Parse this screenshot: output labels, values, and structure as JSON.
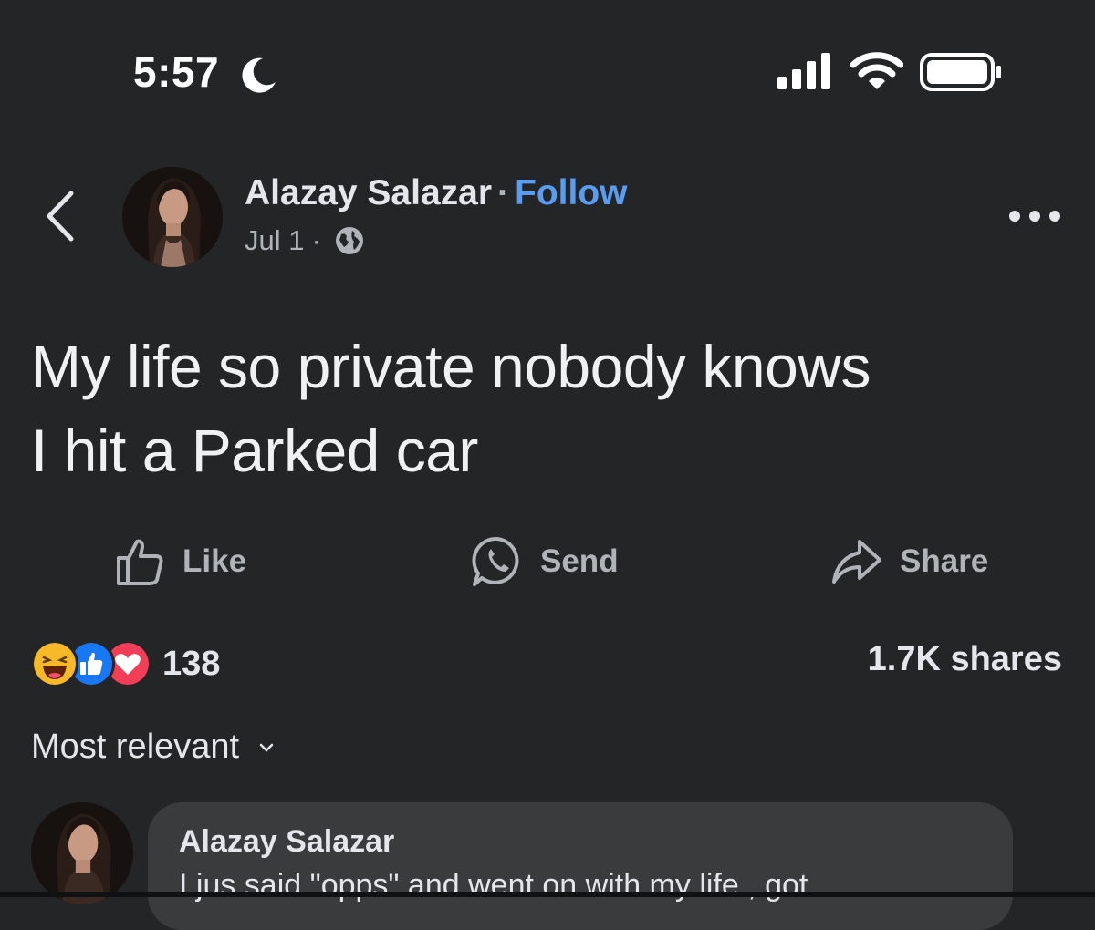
{
  "status_bar": {
    "time": "5:57",
    "icons": [
      "moon-icon",
      "cellular-signal-icon",
      "wifi-icon",
      "battery-icon"
    ]
  },
  "header": {
    "back_icon": "chevron-left-icon",
    "author_name": "Alazay Salazar",
    "separator": "·",
    "follow_label": "Follow",
    "date": "Jul 1",
    "meta_separator": "·",
    "privacy_icon": "globe-icon",
    "more_icon": "more-dots-icon"
  },
  "post": {
    "text_line_1": "My life so private nobody knows",
    "text_line_2": "I hit a Parked car"
  },
  "actions": [
    {
      "label": "Like",
      "icon": "thumbs-up-outline-icon"
    },
    {
      "label": "Send",
      "icon": "whatsapp-icon"
    },
    {
      "label": "Share",
      "icon": "share-arrow-icon"
    }
  ],
  "reactions": {
    "icons": [
      "haha-reaction-icon",
      "like-reaction-icon",
      "love-reaction-icon"
    ],
    "count": "138",
    "shares": "1.7K shares"
  },
  "comments_sort": {
    "label": "Most relevant",
    "icon": "chevron-down-icon"
  },
  "comment": {
    "author": "Alazay Salazar",
    "text": "I jus said \"opps\" and went on with my life , got"
  },
  "colors": {
    "background": "#232527",
    "text_primary": "#e4e6eb",
    "text_secondary": "#b0b3b8",
    "follow_blue": "#5a9cf0",
    "comment_bubble": "#3a3b3c",
    "like_blue": "#1877f2",
    "love_red": "#f33e58",
    "haha_yellow": "#f7b928"
  }
}
